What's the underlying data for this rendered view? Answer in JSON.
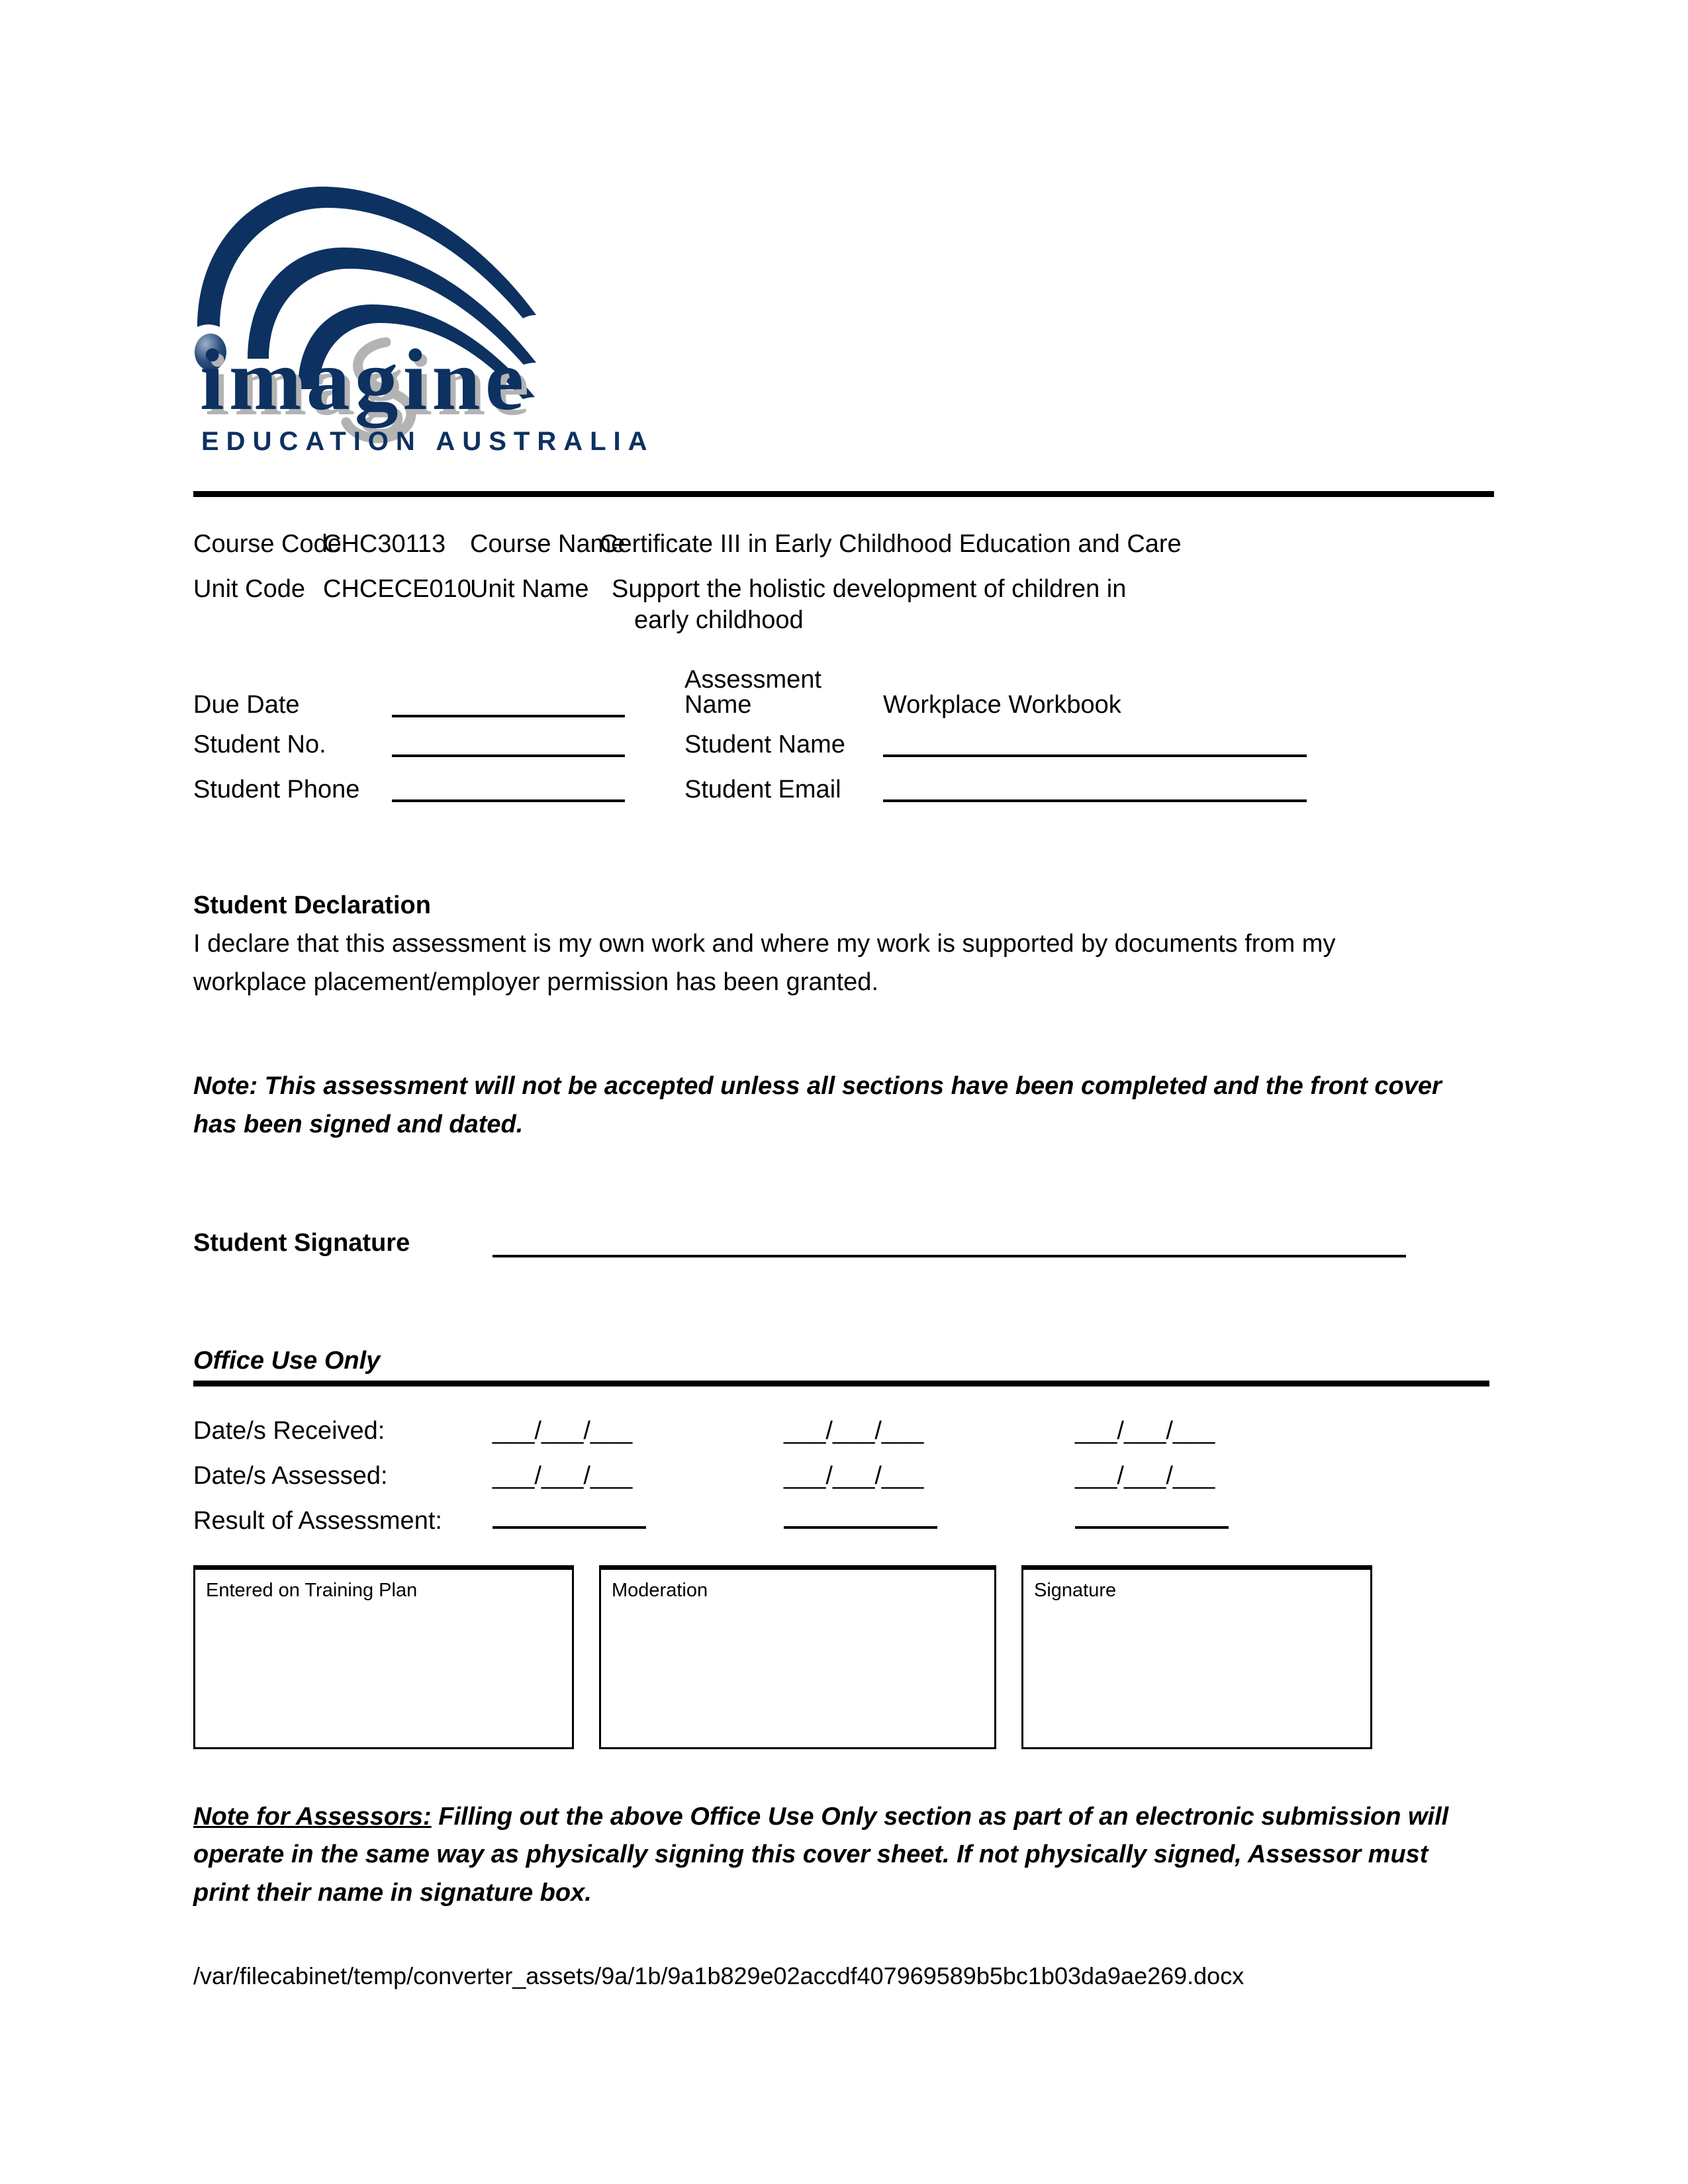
{
  "logo": {
    "wordmark": "imagine",
    "tagline": "EDUCATION AUSTRALIA",
    "navy": "#0d3161",
    "shadow_gray": "#b3b3b3",
    "dot_gradient_light": "#8fa6c4",
    "dot_gradient_dark": "#0d3161"
  },
  "course": {
    "course_code_label": "Course Code",
    "course_code_value": "CHC30113",
    "course_name_label": "Course Name",
    "course_name_value": "Certificate III in Early Childhood Education and Care",
    "unit_code_label": "Unit Code",
    "unit_code_value": "CHCECE010",
    "unit_name_label": "Unit Name",
    "unit_name_value_line1": "Support the holistic development of children in",
    "unit_name_value_line2": "early childhood"
  },
  "student": {
    "due_date_label": "Due Date",
    "due_date_value": "",
    "assessment_name_label": "Assessment Name",
    "assessment_name_value": "Workplace Workbook",
    "student_no_label": "Student No.",
    "student_no_value": "",
    "student_name_label": "Student Name",
    "student_name_value": "",
    "student_phone_label": "Student Phone",
    "student_phone_value": "",
    "student_email_label": "Student Email",
    "student_email_value": ""
  },
  "declaration": {
    "heading": "Student Declaration",
    "body": "I declare that this assessment is my own work and where my work is supported by documents from my workplace placement/employer permission has been granted.",
    "note": "Note: This assessment will not be accepted unless all sections have been completed and the front cover has been signed and dated.",
    "signature_label": "Student Signature",
    "signature_value": ""
  },
  "office": {
    "heading": "Office Use Only",
    "dates_received_label": "Date/s Received:",
    "dates_assessed_label": "Date/s Assessed:",
    "result_label": "Result of Assessment:",
    "date_placeholder": "___/___/___",
    "dates_received": [
      "___/___/___",
      "___/___/___",
      "___/___/___"
    ],
    "dates_assessed": [
      "___/___/___",
      "___/___/___",
      "___/___/___"
    ],
    "results": [
      "",
      "",
      ""
    ],
    "boxes": [
      {
        "label": "Entered on Training Plan",
        "value": ""
      },
      {
        "label": "Moderation",
        "value": ""
      },
      {
        "label": "Signature",
        "value": ""
      }
    ],
    "assessor_note_prefix": "Note for Assessors:",
    "assessor_note_body": "  Filling out the above Office Use Only section as part of an electronic submission will operate in the same way as physically signing this cover sheet. If not physically signed, Assessor must print their name in signature box."
  },
  "footer": {
    "path": "/var/filecabinet/temp/converter_assets/9a/1b/9a1b829e02accdf407969589b5bc1b03da9ae269.docx"
  }
}
